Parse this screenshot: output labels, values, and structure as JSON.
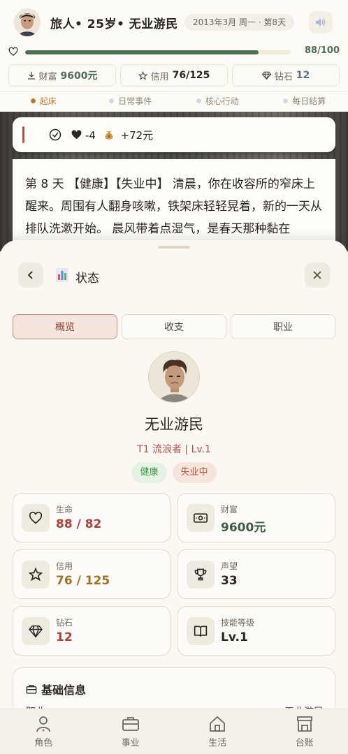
{
  "header": {
    "title": "旅人• 25岁• 无业游民",
    "date": "2013年3月 周一 · 第8天",
    "hp_value": 88,
    "hp_max": 100,
    "hp_text": "88/100",
    "stats": [
      {
        "label": "财富",
        "value": "9600元",
        "icon": "download-icon"
      },
      {
        "label": "信用",
        "value": "76/125",
        "icon": "star-icon"
      },
      {
        "label": "钻石",
        "value": "12",
        "icon": "diamond-icon"
      }
    ],
    "phases": [
      {
        "label": "起床",
        "active": true
      },
      {
        "label": "日常事件",
        "active": false
      },
      {
        "label": "核心行动",
        "active": false
      },
      {
        "label": "每日结算",
        "active": false
      }
    ]
  },
  "event": {
    "hp_change": "-4",
    "money_change": "+72元"
  },
  "story": {
    "text": "第 8 天 【健康】【失业中】 清晨，你在收容所的窄床上醒来。周围有人翻身咳嗽，铁架床轻轻晃着，新的一天从排队洗漱开始。 晨风带着点湿气，是春天那种黏在"
  },
  "sheet": {
    "title": "状态",
    "tabs": [
      "概览",
      "收支",
      "职业"
    ],
    "active_tab": 0,
    "profile": {
      "name": "无业游民",
      "subtitle": "T1 流浪者 | Lv.1",
      "tags": [
        "健康",
        "失业中"
      ]
    },
    "cards": [
      {
        "label": "生命",
        "value": "88 / 82",
        "icon": "heart-icon"
      },
      {
        "label": "财富",
        "value": "9600元",
        "icon": "banknote-icon"
      },
      {
        "label": "信用",
        "value": "76 / 125",
        "icon": "star-icon"
      },
      {
        "label": "声望",
        "value": "33",
        "icon": "trophy-icon"
      },
      {
        "label": "钻石",
        "value": "12",
        "icon": "diamond-icon"
      },
      {
        "label": "技能等级",
        "value": "Lv.1",
        "icon": "book-icon"
      }
    ],
    "info": {
      "title": "基础信息",
      "row_label": "职业",
      "row_value": "无业游民"
    }
  },
  "nav": [
    {
      "label": "角色",
      "icon": "user-icon"
    },
    {
      "label": "事业",
      "icon": "briefcase-icon"
    },
    {
      "label": "生活",
      "icon": "home-icon"
    },
    {
      "label": "台账",
      "icon": "store-icon"
    }
  ],
  "colors": {
    "accent_red": "#b0504a",
    "hp_green": "#4d6e54",
    "phase_active": "#c17a2f"
  }
}
